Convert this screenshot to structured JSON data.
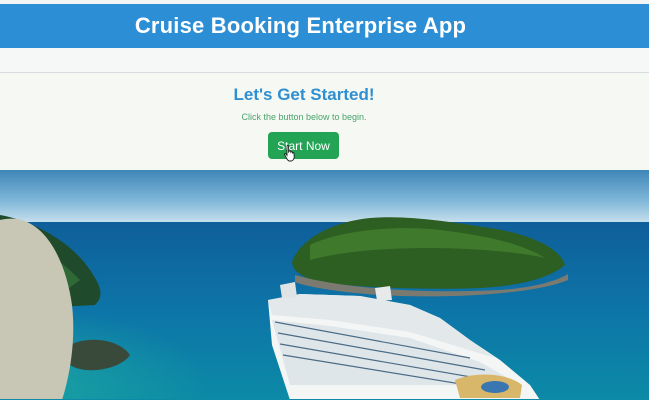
{
  "header": {
    "title": "Cruise Booking Enterprise App"
  },
  "hero": {
    "title": "Let's Get Started!",
    "subtitle": "Click the button below to begin.",
    "button_label": "Start Now"
  },
  "colors": {
    "header": "#2c8fd6",
    "hero_title": "#2f8fd0",
    "button": "#23a455",
    "subtitle": "#4aa36c"
  },
  "icons": {
    "cursor": "hand-pointer-icon"
  }
}
